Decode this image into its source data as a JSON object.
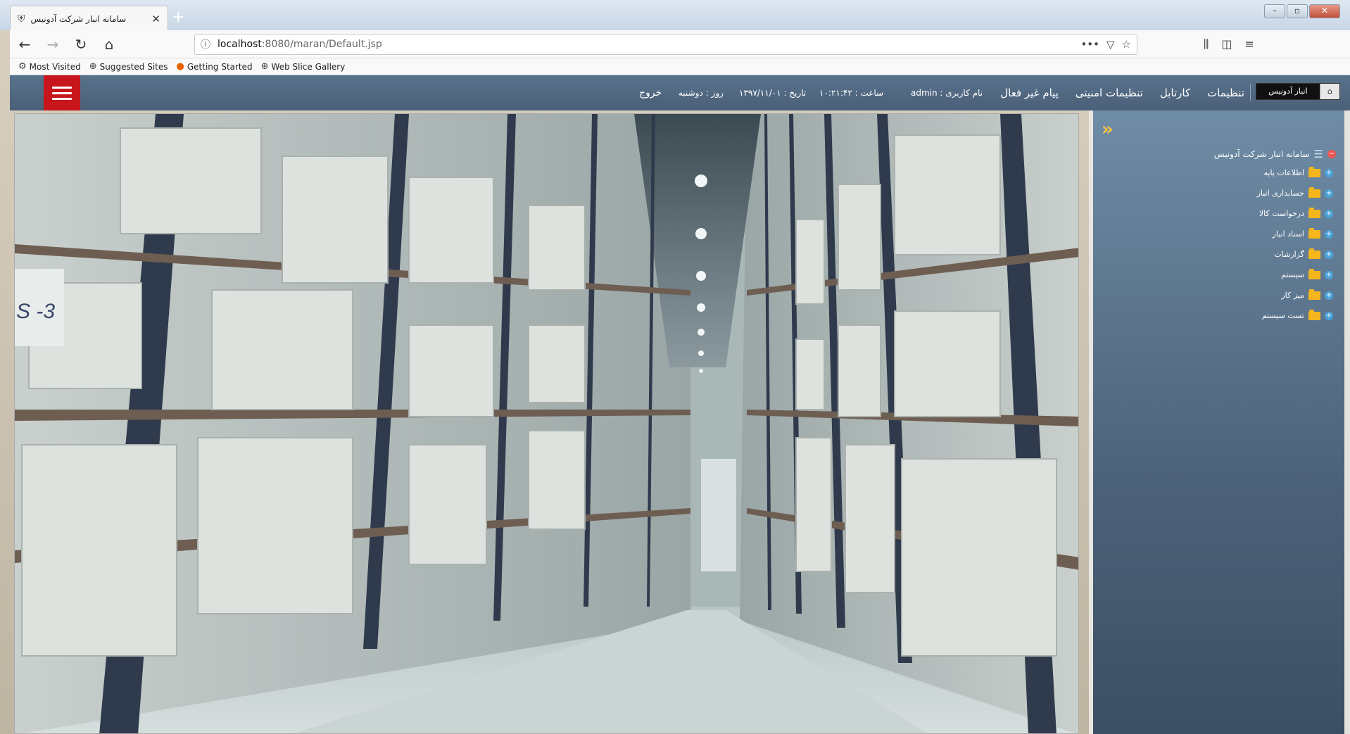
{
  "browser": {
    "tab_title": "سامانه انبار شرکت آدونیس",
    "new_tab": "+",
    "url_host": "localhost",
    "url_path": ":8080/maran/Default.jsp",
    "bookmarks": [
      {
        "label": "Most Visited",
        "icon": "gear-icon"
      },
      {
        "label": "Suggested Sites",
        "icon": "globe-icon"
      },
      {
        "label": "Getting Started",
        "icon": "firefox-icon"
      },
      {
        "label": "Web Slice Gallery",
        "icon": "globe-icon"
      }
    ]
  },
  "header": {
    "brand": "انبار آدونیس",
    "menu": [
      "پیام غیر فعال",
      "تنظیمات امنیتی",
      "کارتابل",
      "تنظیمات"
    ],
    "user_label": "نام کاربری : admin",
    "time_label": "ساعت : ۱۰:۲۱:۴۲",
    "date_label": "تاریخ : ۱۳۹۷/۱۱/۰۱",
    "day_label": "روز : دوشنبه",
    "logout": "خروج"
  },
  "sidebar": {
    "toggle": "»",
    "root": "سامانه انبار شرکت آدونیس",
    "items": [
      {
        "label": "اطلاعات پایه"
      },
      {
        "label": "حسابداری انبار"
      },
      {
        "label": "درخواست کالا"
      },
      {
        "label": "اسناد انبار"
      },
      {
        "label": "گزارشات"
      },
      {
        "label": "سیستم"
      },
      {
        "label": "میز کار"
      },
      {
        "label": "تست سیستم"
      }
    ]
  },
  "hero": {
    "sign_text": "S -3"
  }
}
